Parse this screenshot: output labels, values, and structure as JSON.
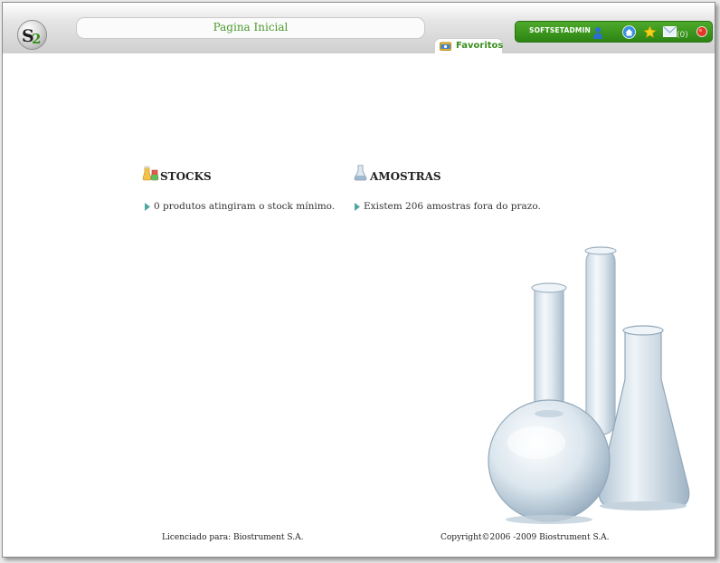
{
  "header": {
    "page_title": "Pagina Inicial",
    "favorites_tab": "Favoritos",
    "user": "SOFTSETADMIN",
    "mail_count": "(0)"
  },
  "icons": {
    "logo": "s2-logo-icon",
    "favorites": "favorites-folder-icon",
    "user": "user-icon",
    "home": "home-icon",
    "star": "star-icon",
    "mail": "mail-icon",
    "logout": "logout-icon",
    "stocks": "stock-icon",
    "amostras": "flask-icon"
  },
  "sections": {
    "stocks": {
      "title": "STOCKS",
      "item": "0 produtos atingiram o stock mínimo."
    },
    "amostras": {
      "title": "AMOSTRAS",
      "item": "Existem 206 amostras fora do prazo."
    }
  },
  "footer": {
    "licensed": "Licenciado para: Biostrument S.A.",
    "copyright": "Copyright©2006 -2009 Biostrument S.A."
  },
  "colors": {
    "accent_green": "#3a8f1f",
    "user_bar_green": "#2c8413",
    "title_text": "#4a9a2f"
  }
}
